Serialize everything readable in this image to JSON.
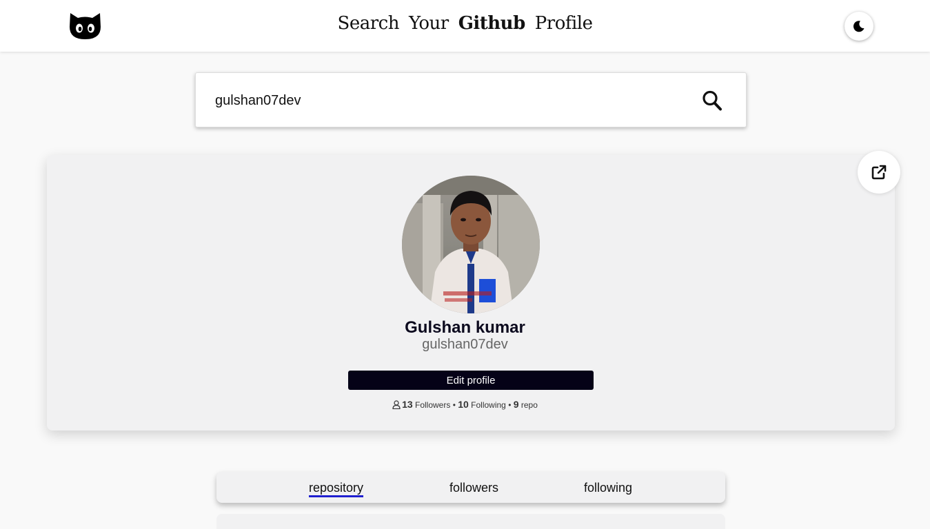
{
  "navbar": {
    "logo_icon": "github-octocat-icon",
    "title_words": [
      "Search",
      "Your",
      "Github",
      "Profile"
    ],
    "theme_toggle_icon": "moon-icon"
  },
  "search": {
    "value": "gulshan07dev",
    "button_icon": "search-icon"
  },
  "profile": {
    "external_link_icon": "external-link-icon",
    "avatar_alt": "avatar",
    "name": "Gulshan kumar",
    "login": "gulshan07dev",
    "edit_label": "Edit profile",
    "stats": {
      "icon": "person-icon",
      "followers_count": "13",
      "followers_label": "Followers",
      "sep1": "•",
      "following_count": "10",
      "following_label": "Following",
      "sep2": "•",
      "repo_count": "9",
      "repo_label": "repo"
    }
  },
  "tabs": [
    {
      "label": "repository",
      "active": true
    },
    {
      "label": "followers",
      "active": false
    },
    {
      "label": "following",
      "active": false
    }
  ],
  "colors": {
    "accent_underline": "#2020d0",
    "edit_button": "#050217",
    "card_background": "#f1f1f2"
  }
}
